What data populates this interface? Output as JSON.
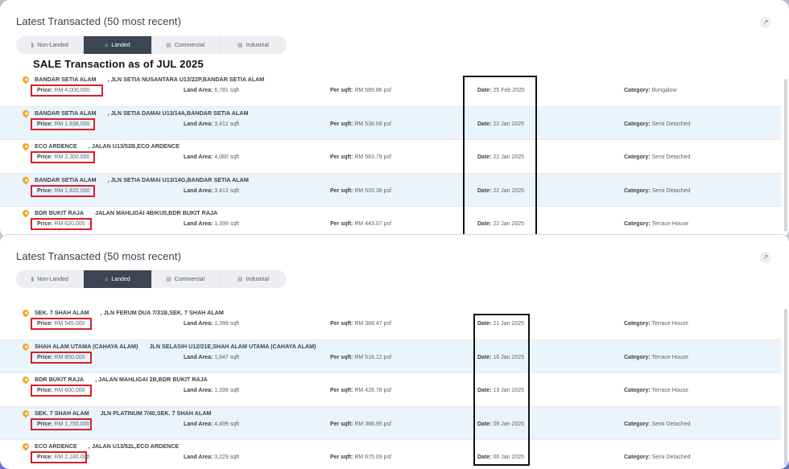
{
  "panels": [
    {
      "title": "Latest Transacted (50 most recent)",
      "tabs": [
        {
          "label": "Non-Landed",
          "icon": "building-icon",
          "active": false
        },
        {
          "label": "Landed",
          "icon": "house-icon",
          "active": true
        },
        {
          "label": "Commercial",
          "icon": "shop-icon",
          "active": false
        },
        {
          "label": "Industrial",
          "icon": "factory-icon",
          "active": false
        }
      ],
      "banner": "SALE Transaction as of JUL 2025",
      "rows": [
        {
          "project": "BANDAR SETIA ALAM",
          "street": ", JLN SETIA NUSANTARA U13/22P,BANDAR SETIA ALAM",
          "price_label": "Price:",
          "price": "RM 4,000,000",
          "area_label": "Land Area:",
          "area": "6,781 sqft",
          "psf_label": "Per sqft:",
          "psf": "RM 589.86 psf",
          "date_label": "Date:",
          "date": "25 Feb 2025",
          "cat_label": "Category:",
          "category": "Bungalow"
        },
        {
          "project": "BANDAR SETIA ALAM",
          "street": ", JLN SETIA DAMAI U13/14A,BANDAR SETIA ALAM",
          "price_label": "Price:",
          "price": "RM 1,838,000",
          "area_label": "Land Area:",
          "area": "3,412 sqft",
          "psf_label": "Per sqft:",
          "psf": "RM 538.66 psf",
          "date_label": "Date:",
          "date": "22 Jan 2025",
          "cat_label": "Category:",
          "category": "Semi Detached"
        },
        {
          "project": "ECO ARDENCE",
          "street": ", JALAN U13/52B,ECO ARDENCE",
          "price_label": "Price:",
          "price": "RM 2,300,000",
          "area_label": "Land Area:",
          "area": "4,080 sqft",
          "psf_label": "Per sqft:",
          "psf": "RM 563.79 psf",
          "date_label": "Date:",
          "date": "22 Jan 2025",
          "cat_label": "Category:",
          "category": "Semi Detached"
        },
        {
          "project": "BANDAR SETIA ALAM",
          "street": ", JLN SETIA DAMAI U13/14G,BANDAR SETIA ALAM",
          "price_label": "Price:",
          "price": "RM 1,820,000",
          "area_label": "Land Area:",
          "area": "3,412 sqft",
          "psf_label": "Per sqft:",
          "psf": "RM 533.38 psf",
          "date_label": "Date:",
          "date": "22 Jan 2025",
          "cat_label": "Category:",
          "category": "Semi Detached"
        },
        {
          "project": "BDR BUKIT RAJA",
          "street": "JALAN MAHLIGAI 4B/KU5,BDR BUKIT RAJA",
          "price_label": "Price:",
          "price": "RM 620,000",
          "area_label": "Land Area:",
          "area": "1,399 sqft",
          "psf_label": "Per sqft:",
          "psf": "RM 443.07 psf",
          "date_label": "Date:",
          "date": "22 Jan 2025",
          "cat_label": "Category:",
          "category": "Terrace House"
        }
      ]
    },
    {
      "title": "Latest Transacted (50 most recent)",
      "tabs": [
        {
          "label": "Non-Landed",
          "icon": "building-icon",
          "active": false
        },
        {
          "label": "Landed",
          "icon": "house-icon",
          "active": true
        },
        {
          "label": "Commercial",
          "icon": "shop-icon",
          "active": false
        },
        {
          "label": "Industrial",
          "icon": "factory-icon",
          "active": false
        }
      ],
      "rows": [
        {
          "project": "SEK. 7 SHAH ALAM",
          "street": ", JLN FERUM DUA 7/31B,SEK. 7 SHAH ALAM",
          "price_label": "Price:",
          "price": "RM 545,000",
          "area_label": "Land Area:",
          "area": "1,399 sqft",
          "psf_label": "Per sqft:",
          "psf": "RM 389.47 psf",
          "date_label": "Date:",
          "date": "21 Jan 2025",
          "cat_label": "Category:",
          "category": "Terrace House"
        },
        {
          "project": "SHAH ALAM UTAMA (CAHAYA ALAM)",
          "street": "JLN SELASIH U12/21E,SHAH ALAM UTAMA (CAHAYA ALAM)",
          "price_label": "Price:",
          "price": "RM 850,000",
          "area_label": "Land Area:",
          "area": "1,647 sqft",
          "psf_label": "Per sqft:",
          "psf": "RM 516.12 psf",
          "date_label": "Date:",
          "date": "16 Jan 2025",
          "cat_label": "Category:",
          "category": "Terrace House"
        },
        {
          "project": "BDR BUKIT RAJA",
          "street": ", JALAN MAHLIGAI 2B,BDR BUKIT RAJA",
          "price_label": "Price:",
          "price": "RM 600,000",
          "area_label": "Land Area:",
          "area": "1,399 sqft",
          "psf_label": "Per sqft:",
          "psf": "RM 428.78 psf",
          "date_label": "Date:",
          "date": "13 Jan 2025",
          "cat_label": "Category:",
          "category": "Terrace House"
        },
        {
          "project": "SEK. 7 SHAH ALAM",
          "street": "JLN PLATINUM 7/40,SEK. 7 SHAH ALAM",
          "price_label": "Price:",
          "price": "RM 1,750,000",
          "area_label": "Land Area:",
          "area": "4,499 sqft",
          "psf_label": "Per sqft:",
          "psf": "RM 388.95 psf",
          "date_label": "Date:",
          "date": "08 Jan 2025",
          "cat_label": "Category:",
          "category": "Semi Detached"
        },
        {
          "project": "ECO ARDENCE",
          "street": ", JALAN U13/52L,ECO ARDENCE",
          "price_label": "Price:",
          "price": "RM 2,180,000",
          "area_label": "Land Area:",
          "area": "3,229 sqft",
          "psf_label": "Per sqft:",
          "psf": "RM 675.09 psf",
          "date_label": "Date:",
          "date": "06 Jan 2025",
          "cat_label": "Category:",
          "category": "Semi Detached"
        }
      ]
    }
  ],
  "colors": {
    "highlight_row": "#eaf4fd",
    "active_tab": "#3b4652",
    "pin": "#f0a928",
    "price_box": "#d4202a",
    "date_box": "#111111"
  }
}
